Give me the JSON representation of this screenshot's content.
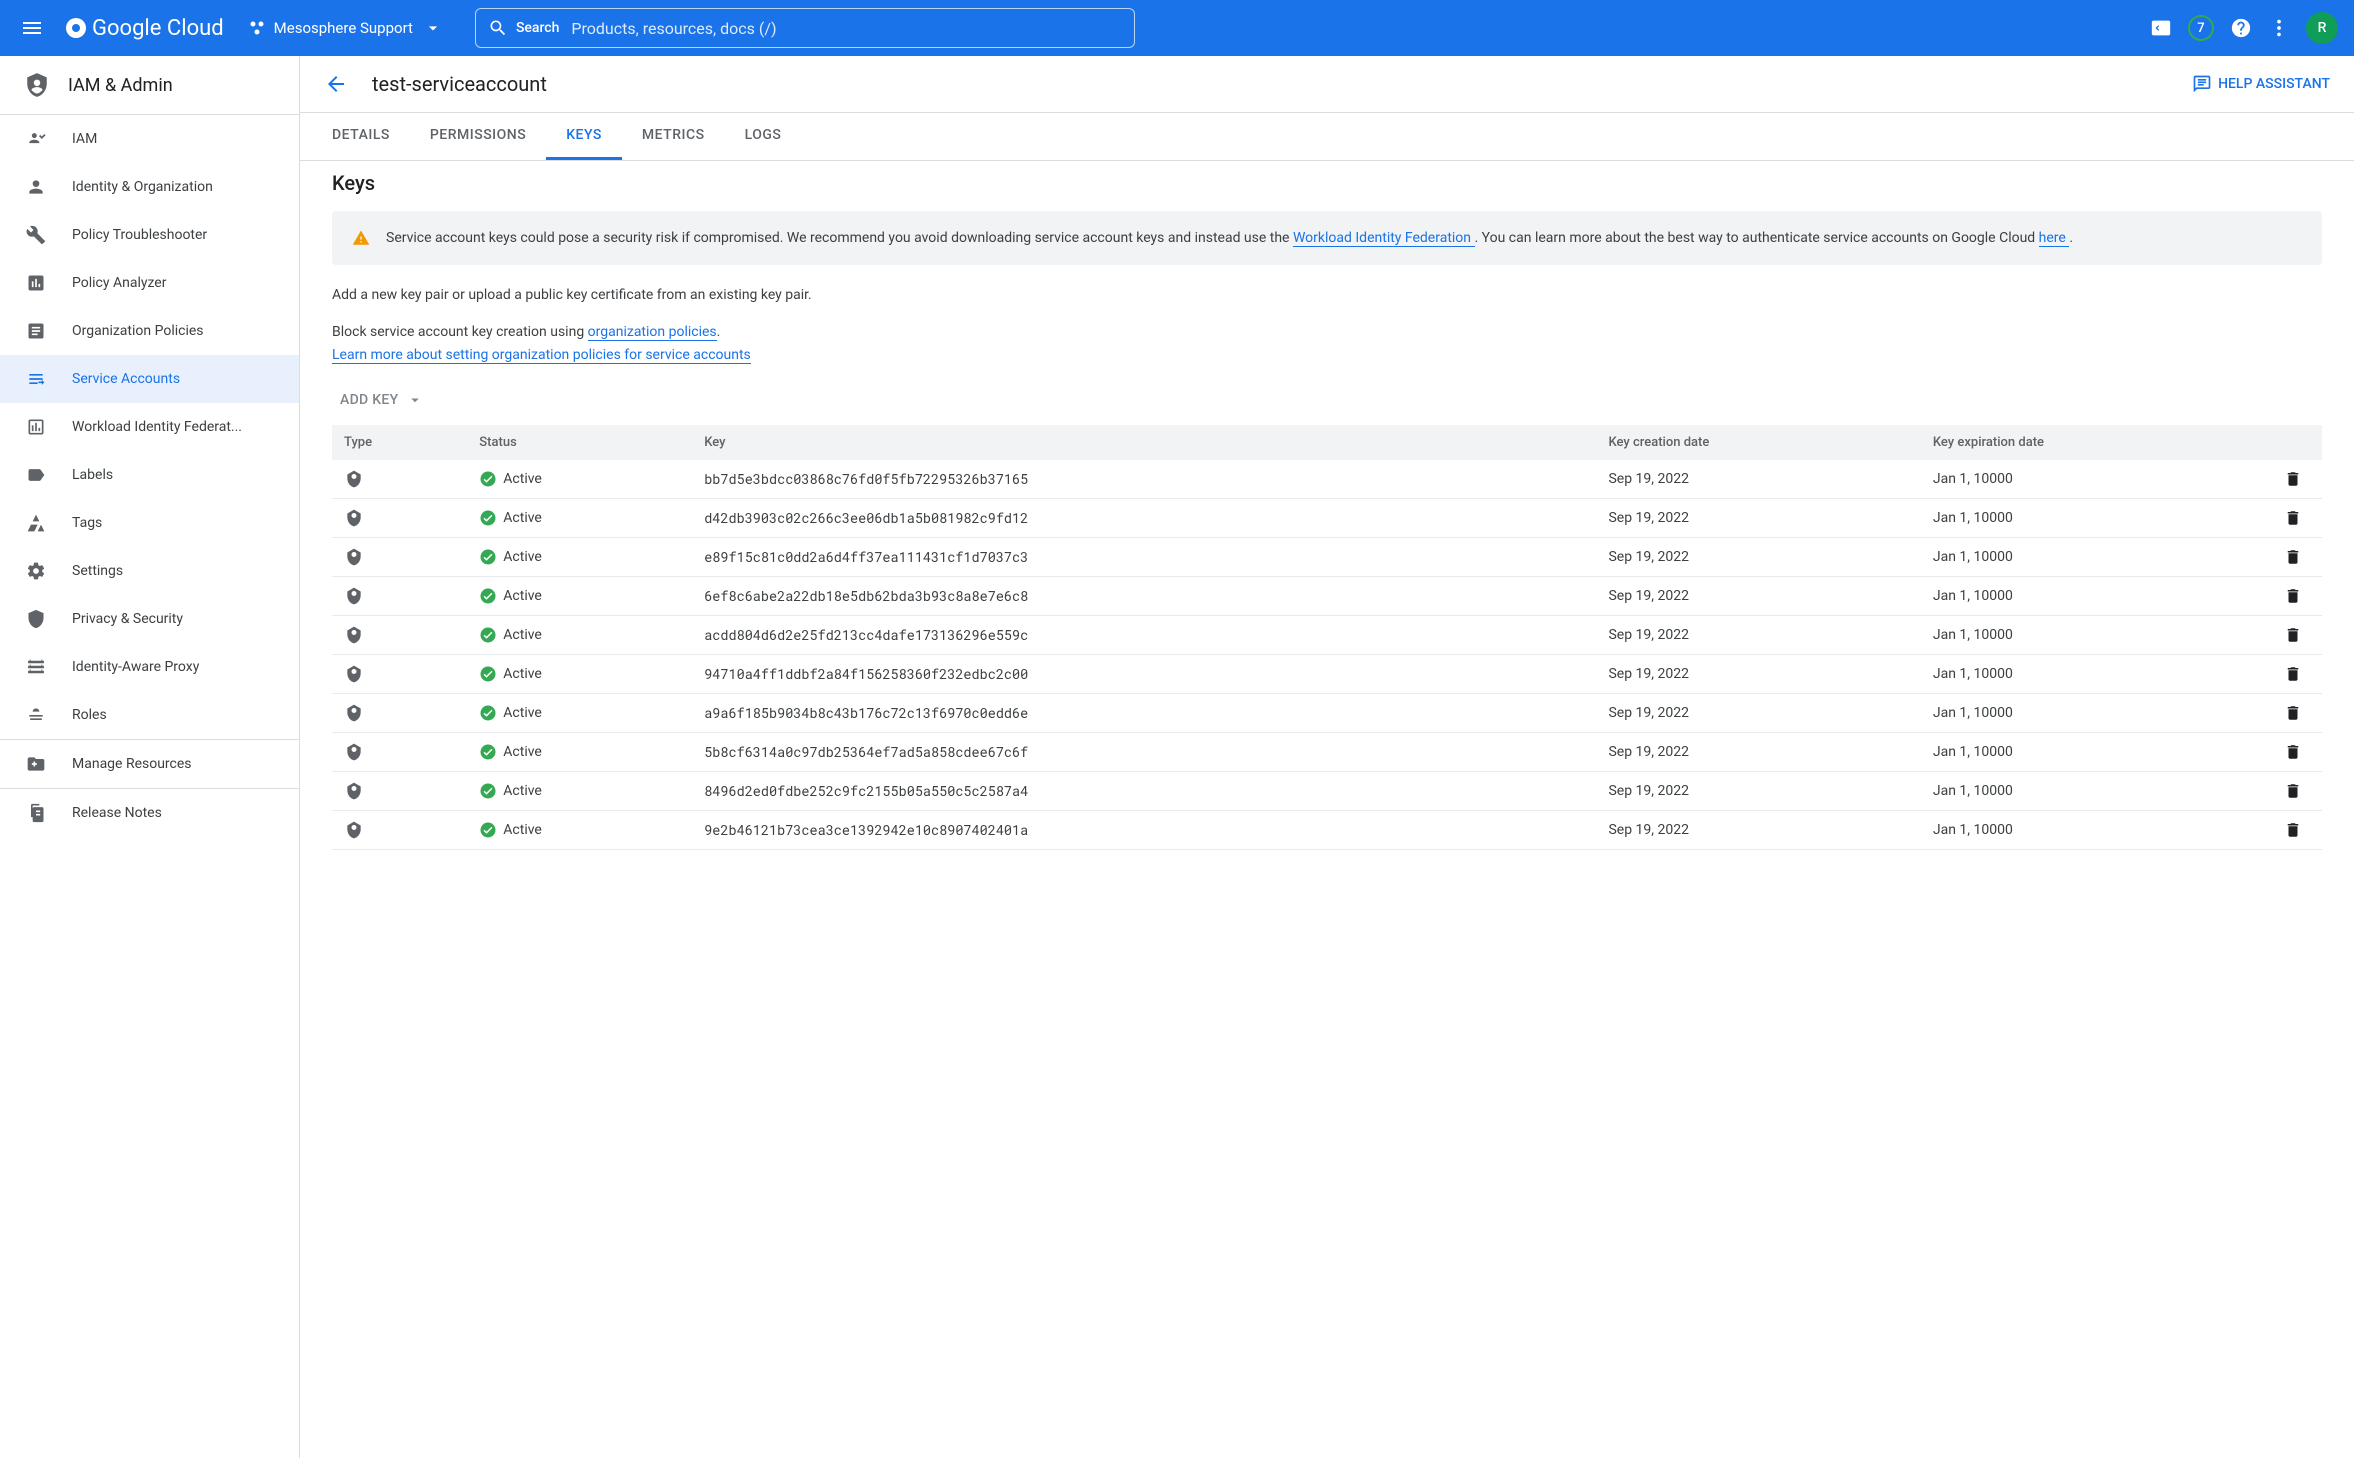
{
  "topbar": {
    "logo_text": "Google Cloud",
    "project_name": "Mesosphere Support",
    "search_label": "Search",
    "search_placeholder": "Products, resources, docs (/)",
    "badge_count": "7",
    "avatar_initial": "R"
  },
  "sidebar": {
    "header": "IAM & Admin",
    "items": [
      {
        "label": "IAM"
      },
      {
        "label": "Identity & Organization"
      },
      {
        "label": "Policy Troubleshooter"
      },
      {
        "label": "Policy Analyzer"
      },
      {
        "label": "Organization Policies"
      },
      {
        "label": "Service Accounts"
      },
      {
        "label": "Workload Identity Federat..."
      },
      {
        "label": "Labels"
      },
      {
        "label": "Tags"
      },
      {
        "label": "Settings"
      },
      {
        "label": "Privacy & Security"
      },
      {
        "label": "Identity-Aware Proxy"
      },
      {
        "label": "Roles"
      },
      {
        "label": "Manage Resources"
      },
      {
        "label": "Release Notes"
      }
    ]
  },
  "page": {
    "title": "test-serviceaccount",
    "help_label": "HELP ASSISTANT",
    "tabs": [
      "DETAILS",
      "PERMISSIONS",
      "KEYS",
      "METRICS",
      "LOGS"
    ],
    "active_tab": "KEYS",
    "section_title": "Keys",
    "warning_pre": "Service account keys could pose a security risk if compromised. We recommend you avoid downloading service account keys and instead use the ",
    "warning_link1": "Workload Identity Federation ",
    "warning_mid": ". You can learn more about the best way to authenticate service accounts on Google Cloud ",
    "warning_link2": "here ",
    "warning_post": ".",
    "add_text": "Add a new key pair or upload a public key certificate from an existing key pair.",
    "block_pre": "Block service account key creation using ",
    "block_link": "organization policies",
    "block_post": ".",
    "learn_link": "Learn more about setting organization policies for service accounts",
    "add_key_label": "ADD KEY"
  },
  "table": {
    "headers": {
      "type": "Type",
      "status": "Status",
      "key": "Key",
      "created": "Key creation date",
      "expires": "Key expiration date"
    },
    "status_active": "Active",
    "rows": [
      {
        "key": "bb7d5e3bdcc03868c76fd0f5fb72295326b37165",
        "created": "Sep 19, 2022",
        "expires": "Jan 1, 10000"
      },
      {
        "key": "d42db3903c02c266c3ee06db1a5b081982c9fd12",
        "created": "Sep 19, 2022",
        "expires": "Jan 1, 10000"
      },
      {
        "key": "e89f15c81c0dd2a6d4ff37ea111431cf1d7037c3",
        "created": "Sep 19, 2022",
        "expires": "Jan 1, 10000"
      },
      {
        "key": "6ef8c6abe2a22db18e5db62bda3b93c8a8e7e6c8",
        "created": "Sep 19, 2022",
        "expires": "Jan 1, 10000"
      },
      {
        "key": "acdd804d6d2e25fd213cc4dafe173136296e559c",
        "created": "Sep 19, 2022",
        "expires": "Jan 1, 10000"
      },
      {
        "key": "94710a4ff1ddbf2a84f156258360f232edbc2c00",
        "created": "Sep 19, 2022",
        "expires": "Jan 1, 10000"
      },
      {
        "key": "a9a6f185b9034b8c43b176c72c13f6970c0edd6e",
        "created": "Sep 19, 2022",
        "expires": "Jan 1, 10000"
      },
      {
        "key": "5b8cf6314a0c97db25364ef7ad5a858cdee67c6f",
        "created": "Sep 19, 2022",
        "expires": "Jan 1, 10000"
      },
      {
        "key": "8496d2ed0fdbe252c9fc2155b05a550c5c2587a4",
        "created": "Sep 19, 2022",
        "expires": "Jan 1, 10000"
      },
      {
        "key": "9e2b46121b73cea3ce1392942e10c8907402401a",
        "created": "Sep 19, 2022",
        "expires": "Jan 1, 10000"
      }
    ]
  }
}
